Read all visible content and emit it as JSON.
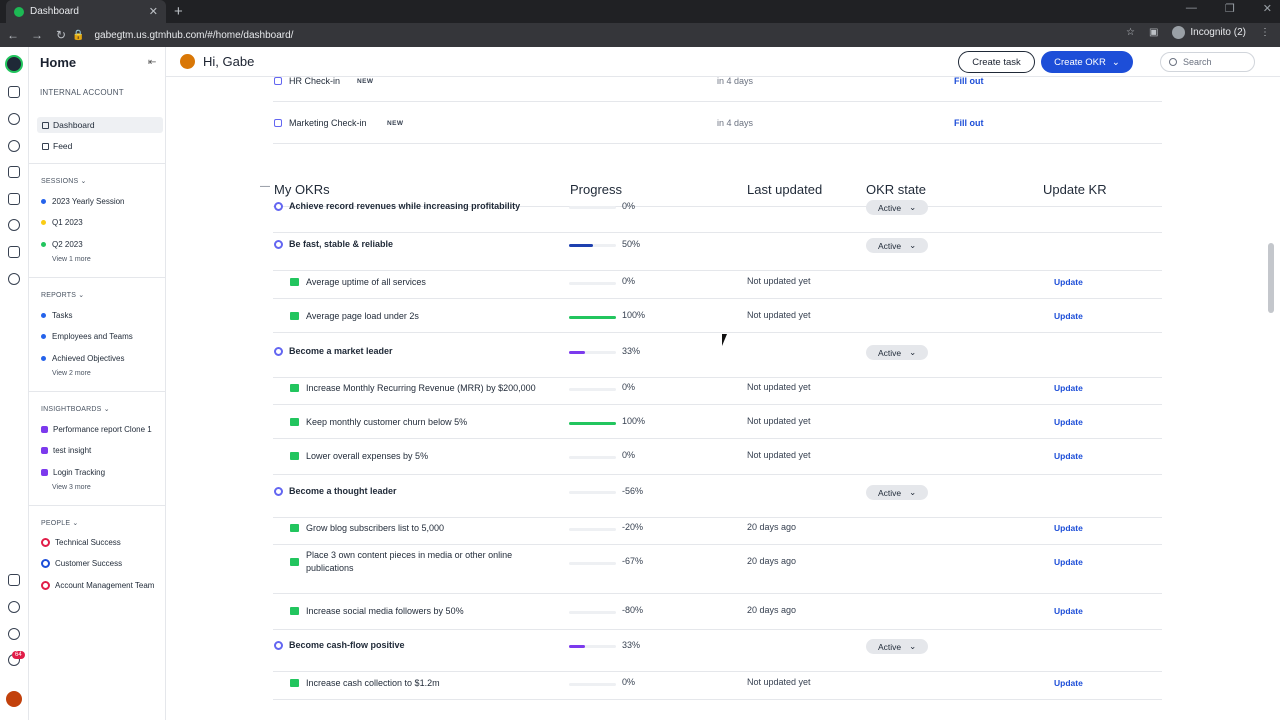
{
  "browser": {
    "tab_title": "Dashboard",
    "url": "gabegtm.us.gtmhub.com/#/home/dashboard/",
    "profile": "Incognito (2)"
  },
  "sidebar": {
    "title": "Home",
    "account": "INTERNAL ACCOUNT",
    "nav": [
      "Dashboard",
      "Feed"
    ],
    "sessions": {
      "heading": "SESSIONS",
      "items": [
        {
          "label": "2023 Yearly Session",
          "color": "#2563eb"
        },
        {
          "label": "Q1 2023",
          "color": "#facc15"
        },
        {
          "label": "Q2 2023",
          "color": "#22c55e"
        }
      ],
      "more": "View 1 more"
    },
    "reports": {
      "heading": "REPORTS",
      "items": [
        "Tasks",
        "Employees and Teams",
        "Achieved Objectives"
      ],
      "more": "View 2 more"
    },
    "insightboards": {
      "heading": "INSIGHTBOARDS",
      "items": [
        "Performance report Clone 1",
        "test insight",
        "Login Tracking"
      ],
      "more": "View 3 more"
    },
    "people": {
      "heading": "PEOPLE",
      "items": [
        "Technical Success",
        "Customer Success",
        "Account Management Team"
      ]
    }
  },
  "rail": {
    "notification_count": "64"
  },
  "header": {
    "greeting": "Hi, Gabe",
    "create_task": "Create task",
    "create_okr": "Create OKR",
    "search_placeholder": "Search"
  },
  "checkins": [
    {
      "title": "HR Check-in",
      "badge": "NEW",
      "due": "in 4 days",
      "action": "Fill out"
    },
    {
      "title": "Marketing Check-in",
      "badge": "NEW",
      "due": "in 4 days",
      "action": "Fill out"
    }
  ],
  "okrs": {
    "section_title": "My OKRs",
    "collapse_glyph": "—",
    "columns": {
      "progress": "Progress",
      "last_updated": "Last updated",
      "state": "OKR state",
      "update": "Update KR"
    },
    "state_label": "Active",
    "update_label": "Update",
    "objectives": [
      {
        "title": "Achieve record revenues while increasing profitability",
        "progress": "0%",
        "fill": 0,
        "color": "#1e40af",
        "krs": []
      },
      {
        "title": "Be fast, stable & reliable",
        "progress": "50%",
        "fill": 0.5,
        "color": "#1e40af",
        "krs": [
          {
            "title": "Average uptime of all services",
            "progress": "0%",
            "fill": 0,
            "updated": "Not updated yet"
          },
          {
            "title": "Average page load under 2s",
            "progress": "100%",
            "fill": 1,
            "updated": "Not updated yet"
          }
        ]
      },
      {
        "title": "Become a market leader",
        "progress": "33%",
        "fill": 0.33,
        "color": "#7c3aed",
        "krs": [
          {
            "title": "Increase Monthly Recurring Revenue (MRR) by $200,000",
            "progress": "0%",
            "fill": 0,
            "updated": "Not updated yet"
          },
          {
            "title": "Keep monthly customer churn below 5%",
            "progress": "100%",
            "fill": 1,
            "updated": "Not updated yet"
          },
          {
            "title": "Lower overall expenses by 5%",
            "progress": "0%",
            "fill": 0,
            "updated": "Not updated yet"
          }
        ]
      },
      {
        "title": "Become a thought leader",
        "progress": "-56%",
        "fill": 0,
        "color": "#1e40af",
        "krs": [
          {
            "title": "Grow blog subscribers list to 5,000",
            "progress": "-20%",
            "fill": 0,
            "updated": "20 days ago"
          },
          {
            "title": "Place 3 own content pieces in media or other online publications",
            "progress": "-67%",
            "fill": 0,
            "updated": "20 days ago"
          },
          {
            "title": "Increase social media followers by 50%",
            "progress": "-80%",
            "fill": 0,
            "updated": "20 days ago"
          }
        ]
      },
      {
        "title": "Become cash-flow positive",
        "progress": "33%",
        "fill": 0.33,
        "color": "#7c3aed",
        "krs": [
          {
            "title": "Increase cash collection to $1.2m",
            "progress": "0%",
            "fill": 0,
            "updated": "Not updated yet"
          }
        ]
      }
    ]
  }
}
